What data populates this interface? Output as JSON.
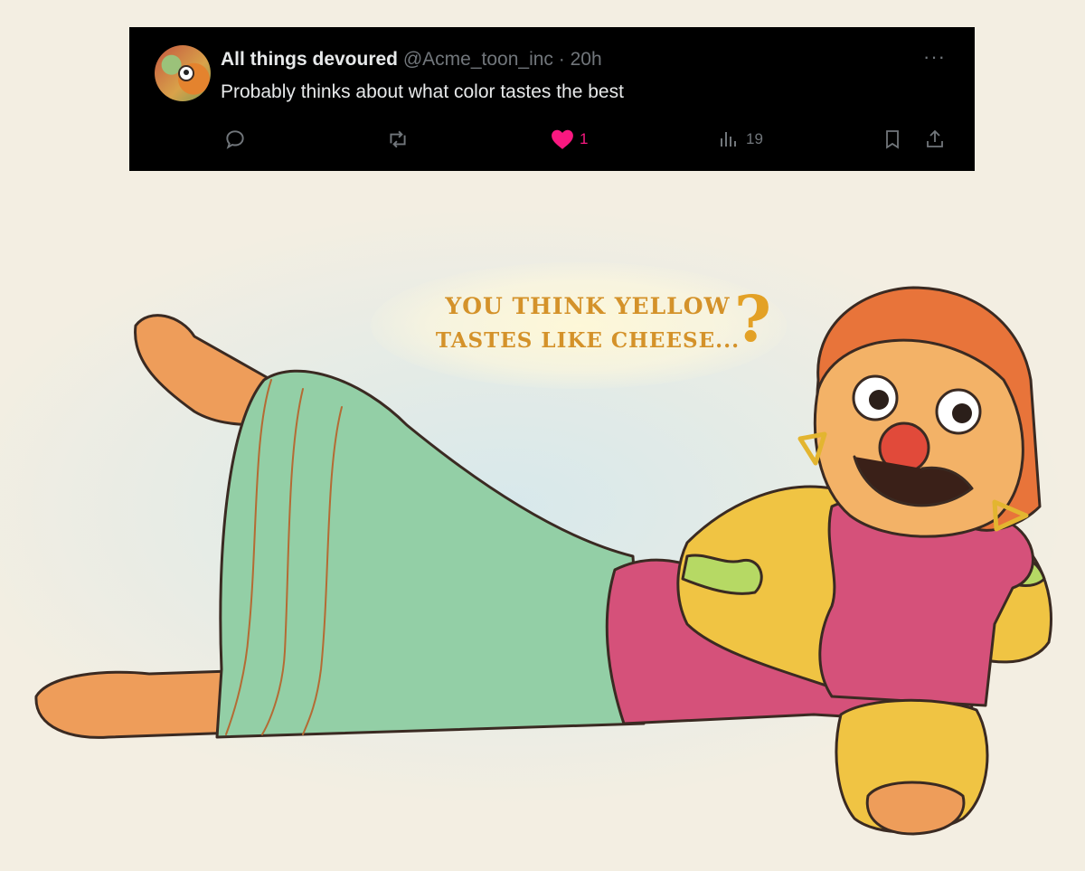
{
  "post": {
    "display_name": "All things devoured",
    "handle": "@Acme_toon_inc",
    "separator": "·",
    "time": "20h",
    "text": "Probably thinks about what color tastes the best",
    "more_glyph": "···",
    "actions": {
      "reply_icon": "reply-icon",
      "repost_icon": "repost-icon",
      "like_icon": "heart-icon",
      "like_count": "1",
      "views_icon": "views-icon",
      "views_count": "19",
      "bookmark_icon": "bookmark-icon",
      "share_icon": "share-icon"
    },
    "colors": {
      "background": "#000000",
      "text": "#e7e9ea",
      "muted": "#71767b",
      "like": "#f91880"
    }
  },
  "artwork": {
    "thought_line1": "YOU THINK YELLOW",
    "thought_line2": "TASTES LIKE CHEESE...",
    "question_mark": "?",
    "colors": {
      "paper": "#f3eee2",
      "skin": "#ee9d5a",
      "hair": "#e8743a",
      "skirt": "#93cfa6",
      "sweater_yellow": "#f0c443",
      "sweater_pink": "#d5517a",
      "nose": "#e14a3a",
      "lettering": "#d4922a"
    }
  }
}
